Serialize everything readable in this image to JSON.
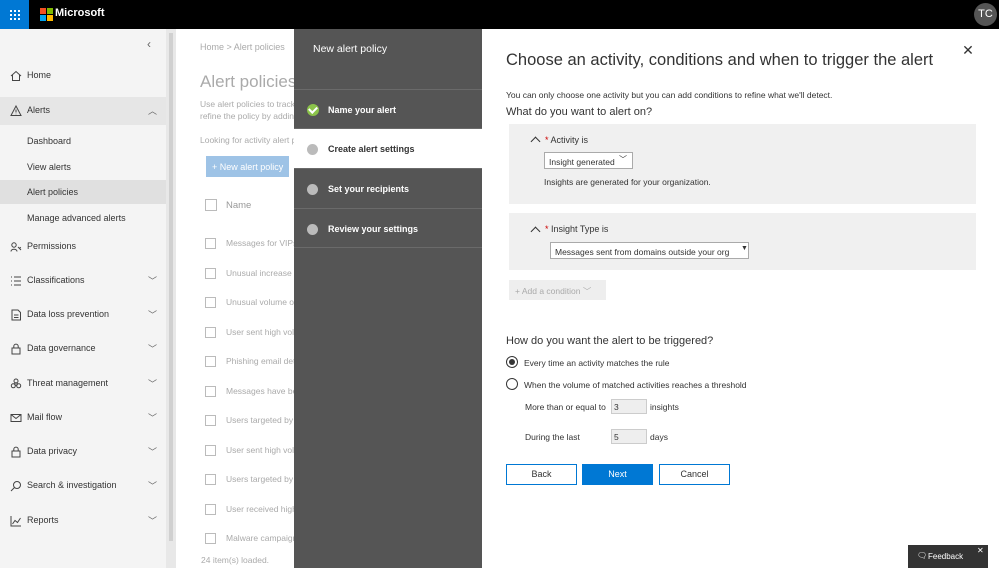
{
  "header": {
    "brand": "Microsoft",
    "avatar_initials": "TC"
  },
  "colors": {
    "accent": "#0078d4",
    "topbar": "#000000",
    "wizard_bg": "#555555",
    "done_check": "#8bc34a"
  },
  "nav": {
    "items": [
      {
        "label": "Home",
        "icon": "home-icon"
      },
      {
        "label": "Alerts",
        "icon": "alert-icon"
      },
      {
        "label": "Permissions",
        "icon": "permissions-icon"
      },
      {
        "label": "Classifications",
        "icon": "list-icon"
      },
      {
        "label": "Data loss prevention",
        "icon": "document-icon"
      },
      {
        "label": "Data governance",
        "icon": "lock-icon"
      },
      {
        "label": "Threat management",
        "icon": "biohazard-icon"
      },
      {
        "label": "Mail flow",
        "icon": "mail-icon"
      },
      {
        "label": "Data privacy",
        "icon": "lock-icon"
      },
      {
        "label": "Search & investigation",
        "icon": "search-icon"
      },
      {
        "label": "Reports",
        "icon": "chart-icon"
      }
    ],
    "alerts_sub": [
      "Dashboard",
      "View alerts",
      "Alert policies",
      "Manage advanced alerts"
    ]
  },
  "background": {
    "breadcrumb": "Home  >  Alert policies",
    "title": "Alert policies",
    "desc_line1": "Use alert policies to track",
    "desc_line2": "refine the policy by addin",
    "look": "Looking for activity alert p",
    "new_button": "+ New alert policy",
    "name_header": "Name",
    "rows": [
      "Messages for VIPs",
      "Unusual increase in",
      "Unusual volume of",
      "User sent high volu",
      "Phishing email det",
      "Messages have bee",
      "Users targeted by",
      "User sent high volu",
      "Users targeted by",
      "User received high",
      "Malware campaign"
    ],
    "loaded": "24 item(s) loaded."
  },
  "wizard": {
    "title": "New alert policy",
    "steps": [
      "Name your alert",
      "Create alert settings",
      "Set your recipients",
      "Review your settings"
    ]
  },
  "panel": {
    "title": "Choose an activity, conditions and when to trigger the alert",
    "desc": "You can only choose one activity but you can add conditions to refine what we'll detect.",
    "q1": "What do you want to alert on?",
    "activity_label": "Activity is",
    "activity_value": "Insight generated",
    "activity_hint": "Insights are generated for your organization.",
    "insight_label": "Insight Type is",
    "insight_value": "Messages sent from domains outside your org",
    "add_condition": "+ Add a condition",
    "q2": "How do you want the alert to be triggered?",
    "opt1": "Every time an activity matches the rule",
    "opt2": "When the volume of matched activities reaches a threshold",
    "threshold_label": "More than or equal to",
    "threshold_value": "3",
    "threshold_unit": "insights",
    "window_label": "During the last",
    "window_value": "5",
    "window_unit": "days",
    "back": "Back",
    "next": "Next",
    "cancel": "Cancel"
  },
  "feedback": "Feedback"
}
